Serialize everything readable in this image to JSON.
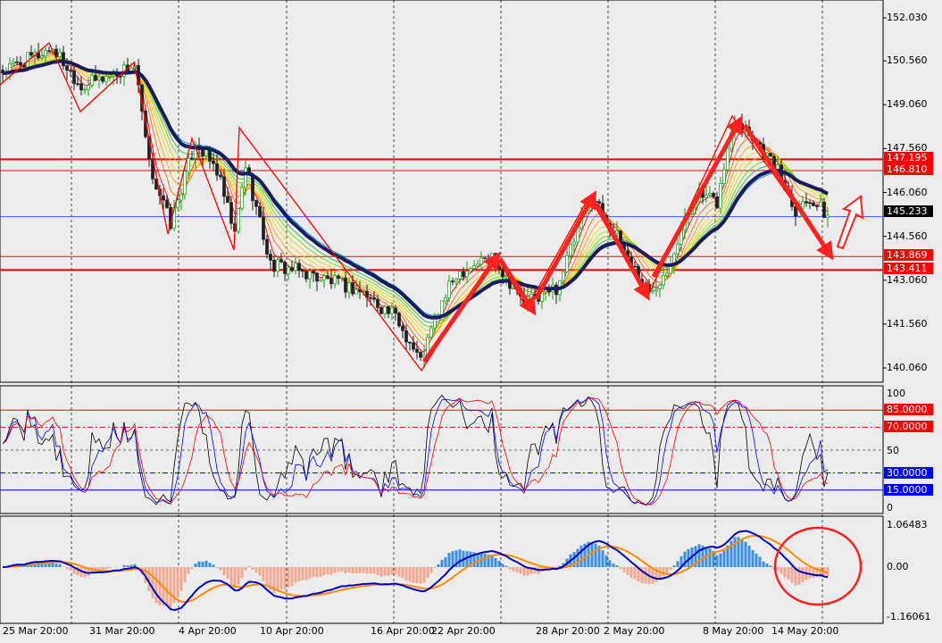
{
  "price_axis": {
    "ticks": [
      "152.030",
      "150.560",
      "149.060",
      "147.560",
      "146.060",
      "144.560",
      "143.060",
      "141.560",
      "140.060"
    ],
    "levels": [
      {
        "label": "147.195",
        "color": "#ff0000"
      },
      {
        "label": "146.810",
        "color": "#ff0000"
      },
      {
        "label": "145.233",
        "color": "#000000"
      },
      {
        "label": "143.869",
        "color": "#ff0000"
      },
      {
        "label": "143.411",
        "color": "#ff0000"
      }
    ]
  },
  "stoch_axis": {
    "top": "100",
    "mid": "50",
    "bottom": "0",
    "levels": [
      {
        "label": "85.0000",
        "color": "#ff0000"
      },
      {
        "label": "70.0000",
        "color": "#ff0000"
      },
      {
        "label": "30.0000",
        "color": "#0000ff"
      },
      {
        "label": "15.0000",
        "color": "#0000ff"
      }
    ]
  },
  "macd_axis": {
    "max": "1.06483",
    "zero": "0.00",
    "min": "-1.16061"
  },
  "time_axis": [
    "25 Mar 20:00",
    "31 Mar 20:00",
    "4 Apr 20:00",
    "10 Apr 20:00",
    "16 Apr 20:00",
    "22 Apr 20:00",
    "28 Apr 20:00",
    "2 May 20:00",
    "8 May 20:00",
    "14 May 20:00"
  ],
  "chart_data": {
    "type": "candlestick",
    "price_range": [
      139.5,
      152.5
    ],
    "price_path": [
      [
        0,
        150.2
      ],
      [
        14,
        151.0
      ],
      [
        22,
        149.7
      ],
      [
        37,
        150.4
      ],
      [
        41,
        147.0
      ],
      [
        47,
        145.0
      ],
      [
        54,
        147.8
      ],
      [
        60,
        146.8
      ],
      [
        65,
        144.6
      ],
      [
        68,
        147.0
      ],
      [
        75,
        143.6
      ],
      [
        85,
        143.3
      ],
      [
        100,
        142.7
      ],
      [
        110,
        141.8
      ],
      [
        117,
        140.3
      ],
      [
        122,
        142.0
      ],
      [
        127,
        143.3
      ],
      [
        137,
        143.9
      ],
      [
        146,
        142.3
      ],
      [
        155,
        142.8
      ],
      [
        165,
        146.0
      ],
      [
        172,
        144.5
      ],
      [
        181,
        142.6
      ],
      [
        186,
        143.5
      ],
      [
        194,
        146.0
      ],
      [
        200,
        145.7
      ],
      [
        205,
        148.7
      ],
      [
        210,
        148.0
      ],
      [
        217,
        146.8
      ],
      [
        222,
        145.5
      ],
      [
        226,
        145.9
      ],
      [
        231,
        145.233
      ]
    ],
    "horizontal_levels": [
      147.195,
      146.81,
      145.233,
      143.869,
      143.411
    ],
    "stoch_levels": [
      85,
      70,
      50,
      30,
      15
    ]
  }
}
